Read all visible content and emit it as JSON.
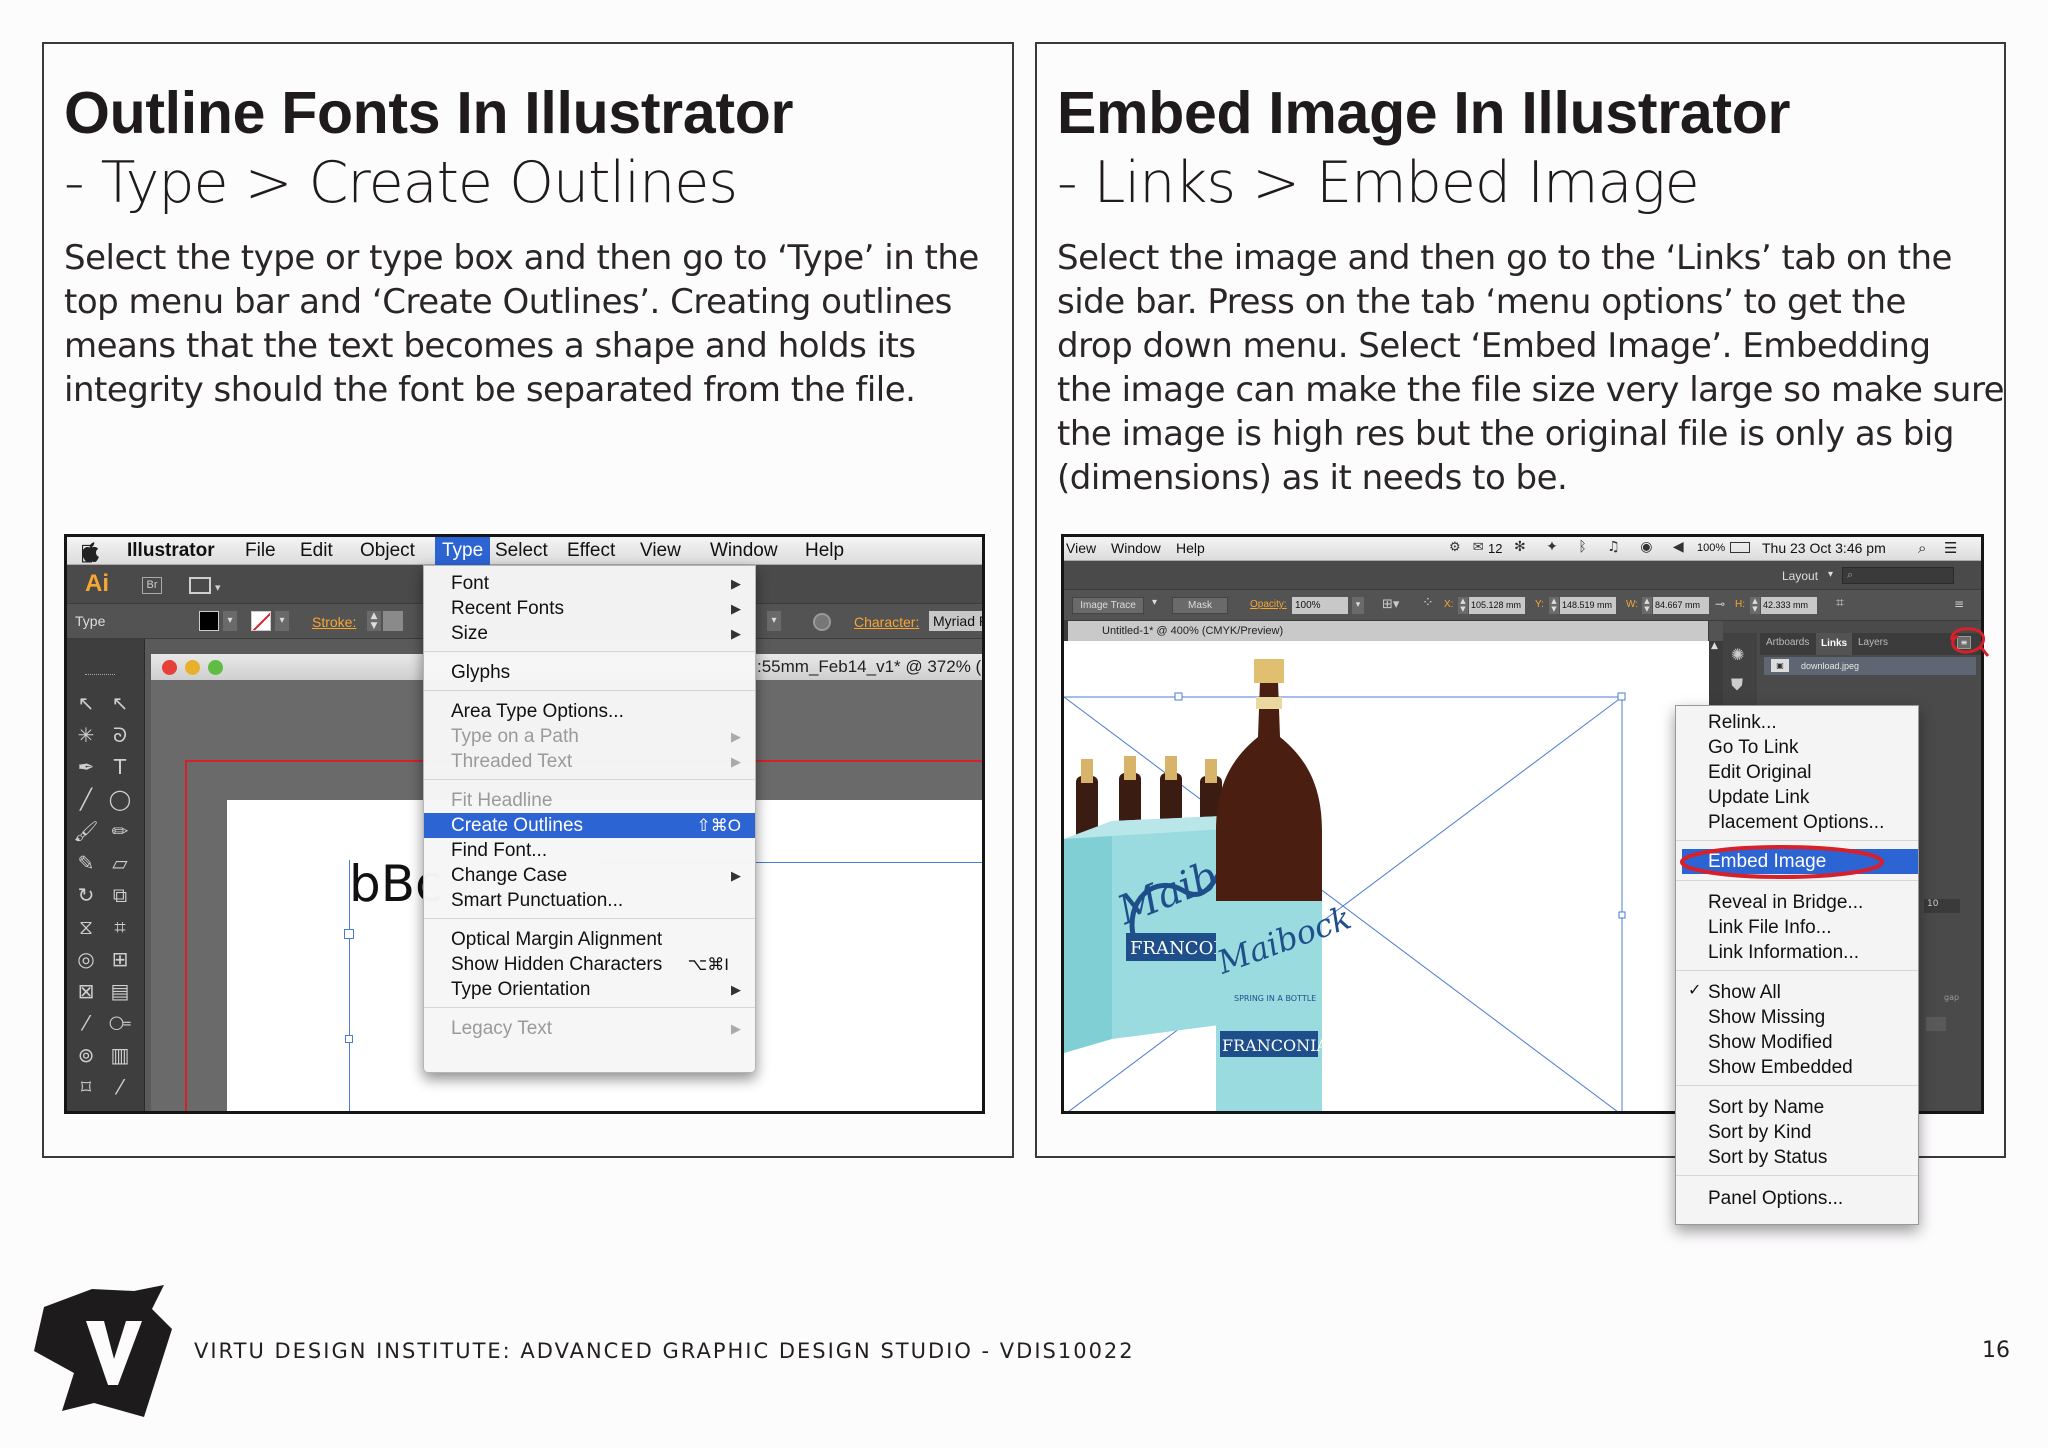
{
  "left": {
    "title": "Outline Fonts In Illustrator",
    "subtitle": "- Type > Create Outlines",
    "body": [
      "Select the type or type box and then go to ‘Type’ in the",
      "top menu bar and ‘Create Outlines’. Creating outlines",
      "means that the text becomes a shape and holds its",
      "integrity should the font be separated from the file."
    ],
    "screenshot": {
      "app_name": "Illustrator",
      "menubar": [
        "File",
        "Edit",
        "Object",
        "Type",
        "Select",
        "Effect",
        "View",
        "Window",
        "Help"
      ],
      "ai_logo": "Ai",
      "br_logo": "Br",
      "panel_label": "Type",
      "stroke_label": "Stroke:",
      "character_label": "Character:",
      "character_value": "Myriad P",
      "doc_title": ":55mm_Feb14_v1* @ 372% (",
      "canvas_text": "bBc",
      "menu": {
        "font": "Font",
        "recent_fonts": "Recent Fonts",
        "size": "Size",
        "glyphs": "Glyphs",
        "area_type_options": "Area Type Options...",
        "type_on_a_path": "Type on a Path",
        "threaded_text": "Threaded Text",
        "fit_headline": "Fit Headline",
        "create_outlines": "Create Outlines",
        "create_outlines_shortcut": "⇧⌘O",
        "find_font": "Find Font...",
        "change_case": "Change Case",
        "smart_punctuation": "Smart Punctuation...",
        "optical_margin": "Optical Margin Alignment",
        "show_hidden": "Show Hidden Characters",
        "show_hidden_shortcut": "⌥⌘I",
        "type_orientation": "Type Orientation",
        "legacy_text": "Legacy Text"
      }
    }
  },
  "right": {
    "title": "Embed Image In Illustrator",
    "subtitle": "- Links > Embed Image",
    "body": [
      "Select the image and then go to the ‘Links’ tab on the",
      "side bar. Press on the tab ‘menu options’ to get the",
      "drop down menu. Select ‘Embed Image’. Embedding",
      "the image can make the file size very large so make sure",
      "the image is high res but the original file is only as big",
      "(dimensions) as it needs to be."
    ],
    "screenshot": {
      "menubar": [
        "View",
        "Window",
        "Help"
      ],
      "status_num": "12",
      "zoom_status": "100%",
      "datetime": "Thu 23 Oct  3:46 pm",
      "layout_label": "Layout",
      "image_trace": "Image Trace",
      "mask": "Mask",
      "opacity_label": "Opacity:",
      "opacity_value": "100%",
      "x_label": "X:",
      "x_value": "105.128 mm",
      "y_label": "Y:",
      "y_value": "148.519 mm",
      "w_label": "W:",
      "w_value": "84.667 mm",
      "h_label": "H:",
      "h_value": "42.333 mm",
      "doc_tab": "Untitled-1* @ 400% (CMYK/Preview)",
      "panel_tabs": [
        "Artboards",
        "Links",
        "Layers"
      ],
      "link_file": "download.jpeg",
      "side_value": "10",
      "side_gap": "gap",
      "brand1": "Maibock",
      "brand_sub": "SPRING IN A BOTTLE",
      "brand2": "FRANCONIA",
      "menu": {
        "relink": "Relink...",
        "go_to_link": "Go To Link",
        "edit_original": "Edit Original",
        "update_link": "Update Link",
        "placement_options": "Placement Options...",
        "embed_image": "Embed Image",
        "reveal_in_bridge": "Reveal in Bridge...",
        "link_file_info": "Link File Info...",
        "link_information": "Link Information...",
        "show_all": "Show All",
        "show_missing": "Show Missing",
        "show_modified": "Show Modified",
        "show_embedded": "Show Embedded",
        "sort_by_name": "Sort by Name",
        "sort_by_kind": "Sort by Kind",
        "sort_by_status": "Sort by Status",
        "panel_options": "Panel Options..."
      }
    }
  },
  "footer": {
    "text": "VIRTU DESIGN INSTITUTE: ADVANCED GRAPHIC DESIGN STUDIO - VDIS10022",
    "page_number": "16"
  },
  "colors": {
    "menu_highlight": "#2d64d4",
    "ai_orange": "#f7a533",
    "annotation_red": "#d8202a",
    "frame": "#3a3a3a"
  }
}
